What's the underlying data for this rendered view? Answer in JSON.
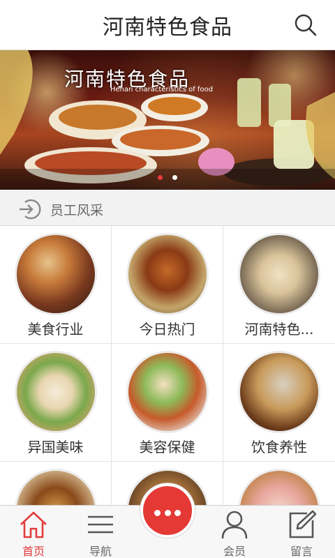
{
  "header": {
    "title": "河南特色食品",
    "search_icon": "search-icon"
  },
  "banner": {
    "title": "河南特色食品",
    "subtitle": "Henan characteristics of food",
    "slide_count": 2,
    "active_slide": 1
  },
  "section": {
    "title": "员工风采",
    "icon": "login-arrow-icon"
  },
  "grid": {
    "items": [
      {
        "label": "美食行业"
      },
      {
        "label": "今日热门"
      },
      {
        "label": "河南特色..."
      },
      {
        "label": "异国美味"
      },
      {
        "label": "美容保健"
      },
      {
        "label": "饮食养性"
      },
      {
        "label": ""
      },
      {
        "label": ""
      },
      {
        "label": ""
      }
    ]
  },
  "nav": {
    "items": [
      {
        "label": "首页",
        "icon": "home-icon",
        "active": true
      },
      {
        "label": "导航",
        "icon": "menu-icon",
        "active": false
      },
      {
        "label": "会员",
        "icon": "user-icon",
        "active": false
      },
      {
        "label": "留言",
        "icon": "edit-icon",
        "active": false
      }
    ],
    "center_icon": "more-dots-icon"
  },
  "colors": {
    "accent": "#e53935",
    "active_nav": "#e23b3b"
  }
}
